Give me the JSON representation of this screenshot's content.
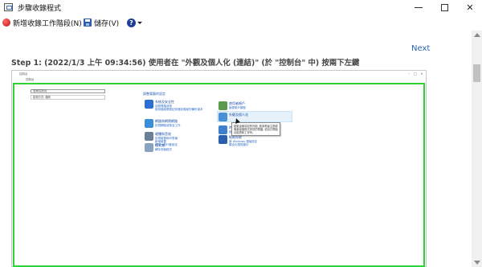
{
  "window": {
    "title": "步驟收錄程式",
    "controls": {
      "minimize": "",
      "maximize": "",
      "close": "✕"
    }
  },
  "toolbar": {
    "new_recording_label": "新增收錄工作階段(N)",
    "save_label": "儲存(V)",
    "help_label": "?"
  },
  "navigation": {
    "next_label": "Next"
  },
  "step": {
    "heading": "Step 1: (2022/1/3 上午 09:34:56) 使用者在 \"外觀及個人化 (連結)\" (於 \"控制台\" 中) 按兩下左鍵"
  },
  "screenshot": {
    "mini_title": "控制台",
    "mini_address": "控制台",
    "mini_search_text": "搜尋控制台",
    "mini_filter_text": "檢視方式: 類別",
    "adjust_settings": "調整電腦的設定",
    "tooltip_text": "變更桌面項目的外觀, 套用佈景主題或螢幕保護程式到您的電腦, 或自訂開始功能表和工作列。",
    "categories_left": [
      {
        "title": "系統及安全性",
        "subs": [
          "檢閱電腦狀態",
          "使用檔案歷程記錄儲存檔案的備份複本"
        ],
        "color": "#2a6fd1",
        "icon": "shield-icon"
      },
      {
        "title": "網路和網際網路",
        "subs": [
          "檢視網路狀態及工作"
        ],
        "color": "#3b8fd9",
        "icon": "globe-icon"
      },
      {
        "title": "硬體和音效",
        "subs": [
          "檢視裝置和印表機",
          "新增裝置",
          "調整一般行動設定"
        ],
        "color": "#6b7f95",
        "icon": "printer-icon"
      },
      {
        "title": "程式集",
        "subs": [
          "解除安裝程式"
        ],
        "color": "#8aa3c0",
        "icon": "programs-icon"
      }
    ],
    "categories_right": [
      {
        "title": "使用者帳戶",
        "subs": [
          "變更帳戶類型"
        ],
        "color": "#5a9a4a",
        "icon": "users-icon"
      },
      {
        "title": "外觀及個人化",
        "subs": [],
        "color": "#4a90d9",
        "icon": "appearance-icon"
      },
      {
        "title": "時鐘和區域",
        "subs": [
          "變更日期、時間或數字格式"
        ],
        "color": "#3f7fd0",
        "icon": "clock-icon"
      },
      {
        "title": "輕鬆存取",
        "subs": [
          "讓 Windows 建議設定",
          "最佳化視覺顯示"
        ],
        "color": "#2a5fb0",
        "icon": "accessibility-icon"
      }
    ]
  }
}
